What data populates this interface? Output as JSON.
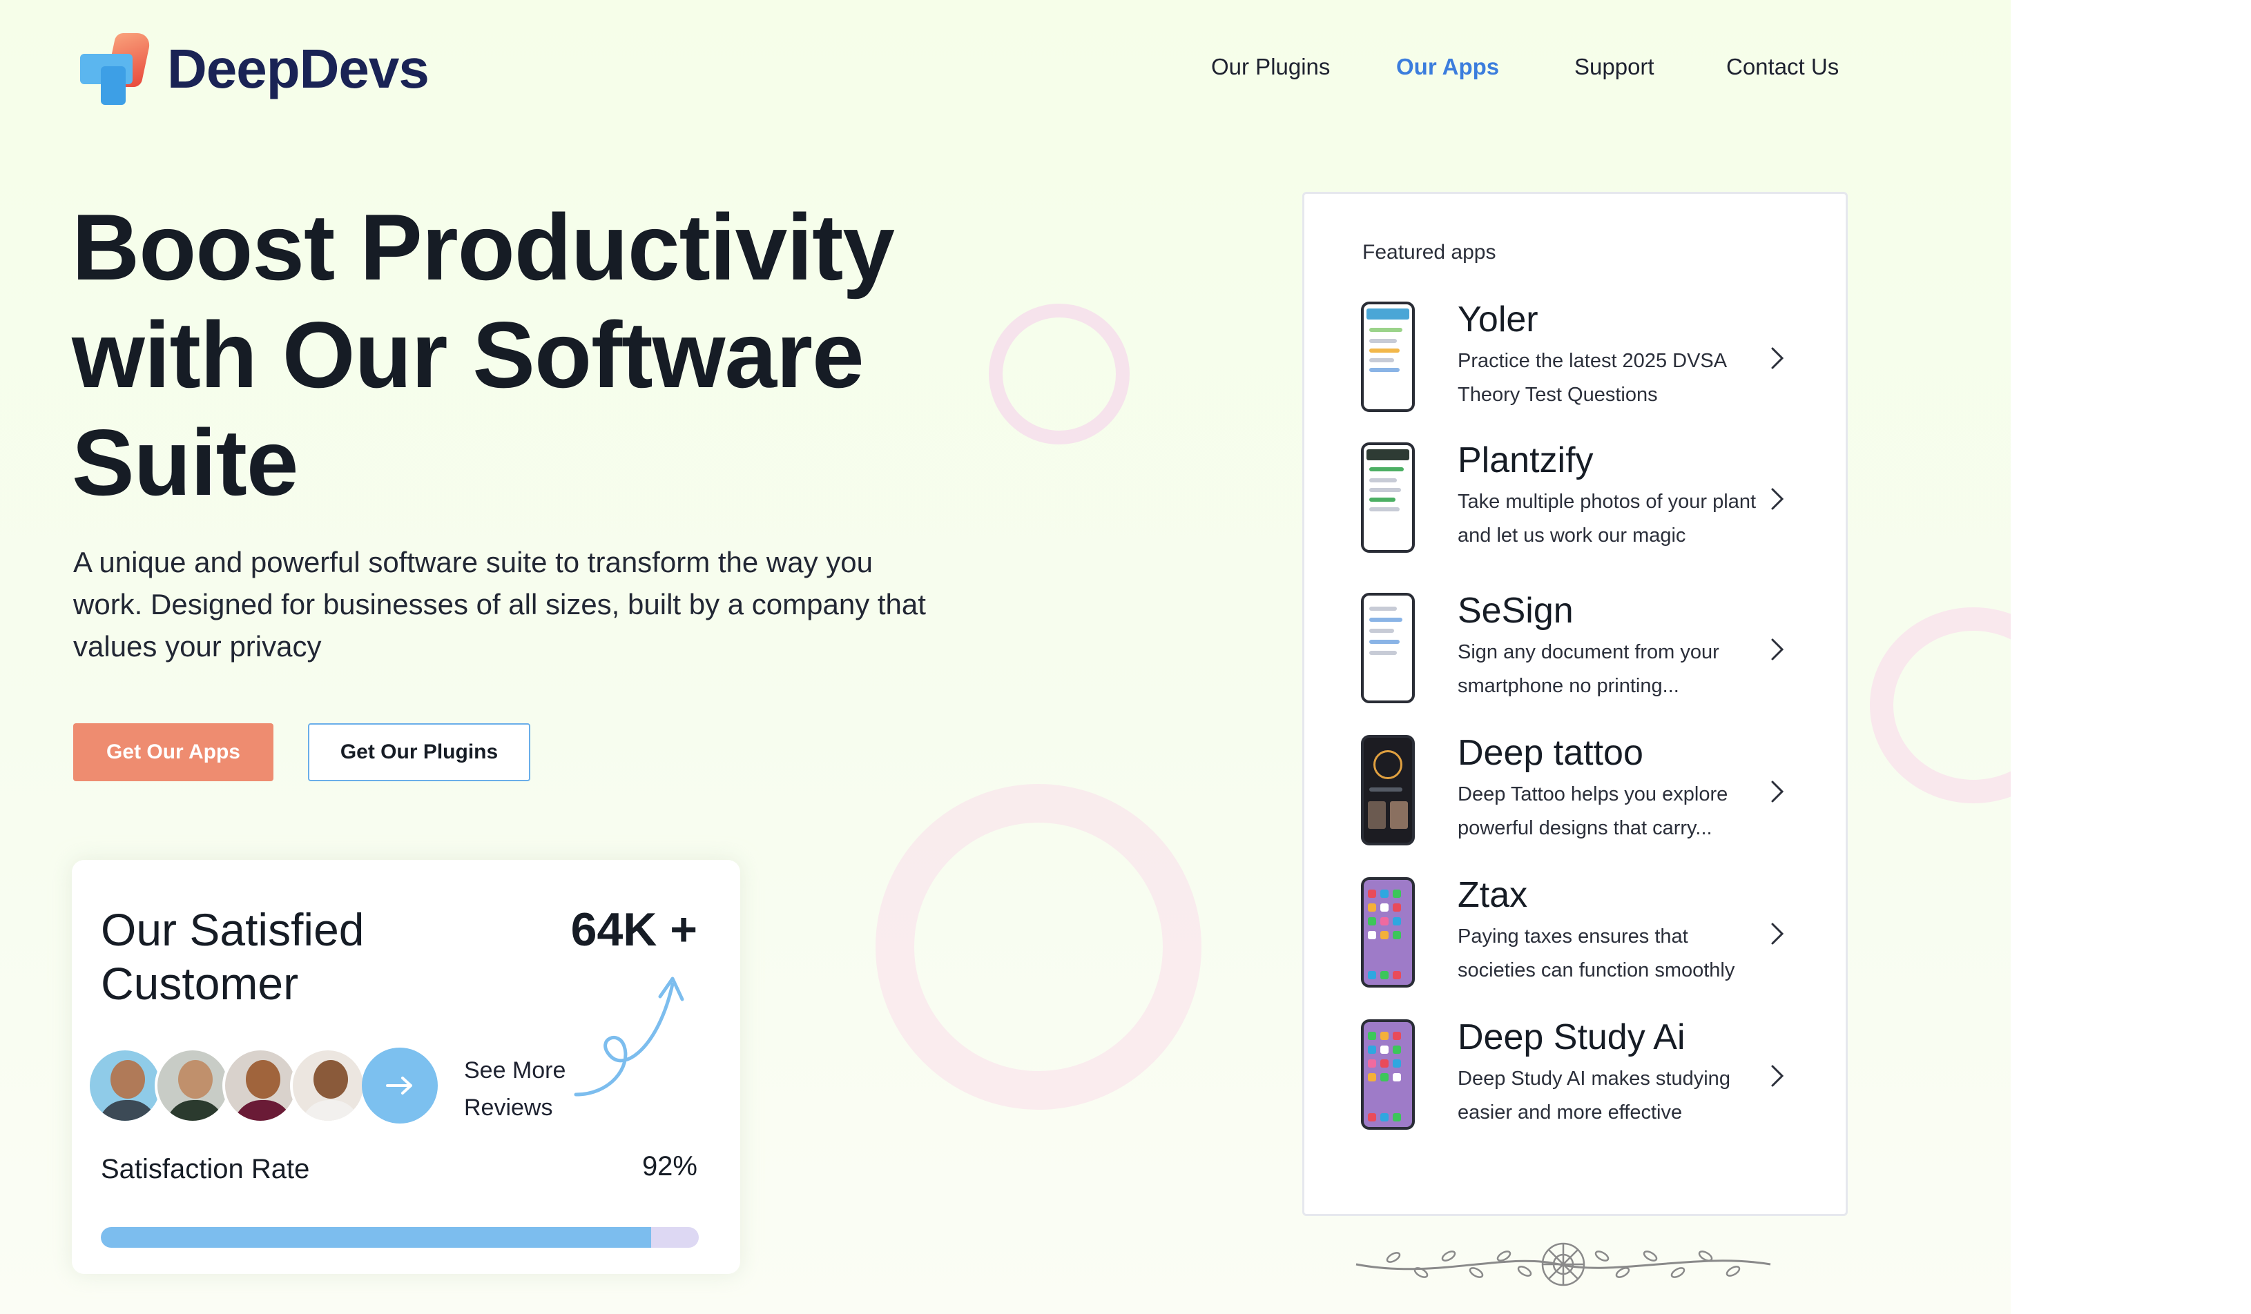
{
  "header": {
    "brand": "DeepDevs",
    "nav": [
      {
        "label": "Our Plugins",
        "active": false
      },
      {
        "label": "Our Apps",
        "active": true
      },
      {
        "label": "Support",
        "active": false
      },
      {
        "label": "Contact Us",
        "active": false
      }
    ]
  },
  "hero": {
    "title": "Boost Productivity with Our Software Suite",
    "subtitle": "A unique and powerful software suite to transform the way you work. Designed for businesses of all sizes, built by a company that values your privacy",
    "primary_button": "Get Our Apps",
    "secondary_button": "Get Our Plugins"
  },
  "customers": {
    "title": "Our Satisfied Customer",
    "count": "64K +",
    "see_more": "See More Reviews",
    "rate_label": "Satisfaction Rate",
    "rate_value": "92%",
    "rate_fraction": 0.92
  },
  "featured": {
    "heading": "Featured apps",
    "apps": [
      {
        "name": "Yoler",
        "desc": "Practice the latest 2025 DVSA Theory Test Questions",
        "icon": "phone-screenshot-icon"
      },
      {
        "name": "Plantzify",
        "desc": "Take multiple photos of your plant and let us work our magic",
        "icon": "phone-screenshot-icon"
      },
      {
        "name": "SeSign",
        "desc": "Sign any document from your smartphone no printing...",
        "icon": "phone-screenshot-icon"
      },
      {
        "name": "Deep tattoo",
        "desc": "Deep Tattoo helps you explore powerful designs that carry...",
        "icon": "phone-screenshot-icon"
      },
      {
        "name": "Ztax",
        "desc": "Paying taxes ensures that societies can function smoothly",
        "icon": "phone-screenshot-icon"
      },
      {
        "name": "Deep Study Ai",
        "desc": "Deep Study AI makes studying easier and more effective",
        "icon": "phone-screenshot-icon"
      }
    ]
  },
  "colors": {
    "accent": "#3b7ddd",
    "primary_button": "#ee8c70",
    "progress": "#7cbdee",
    "brand_text": "#1a2355"
  }
}
